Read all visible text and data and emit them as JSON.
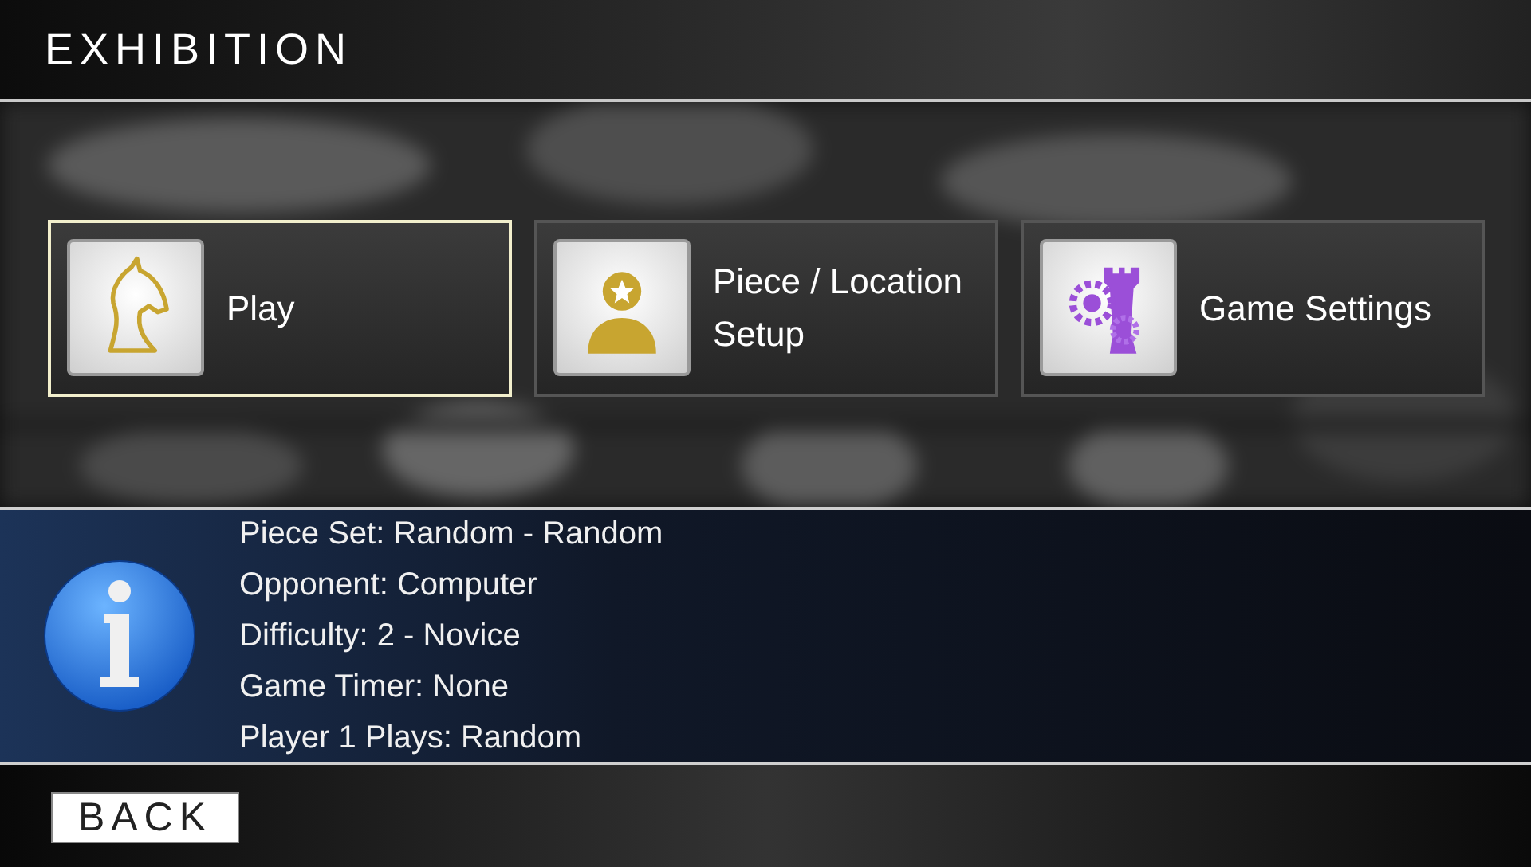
{
  "header": {
    "title": "EXHIBITION"
  },
  "menu": [
    {
      "label": "Play",
      "kind": "knight",
      "selected": true
    },
    {
      "label": "Piece / Location Setup",
      "kind": "person",
      "selected": false
    },
    {
      "label": "Game Settings",
      "kind": "settings",
      "selected": false
    }
  ],
  "info": {
    "lines": [
      "Piece Set: Random - Random",
      "Opponent: Computer",
      "Difficulty: 2 - Novice",
      "Game Timer: None",
      "Player 1 Plays: Random"
    ]
  },
  "footer": {
    "back_button": "BACK"
  }
}
